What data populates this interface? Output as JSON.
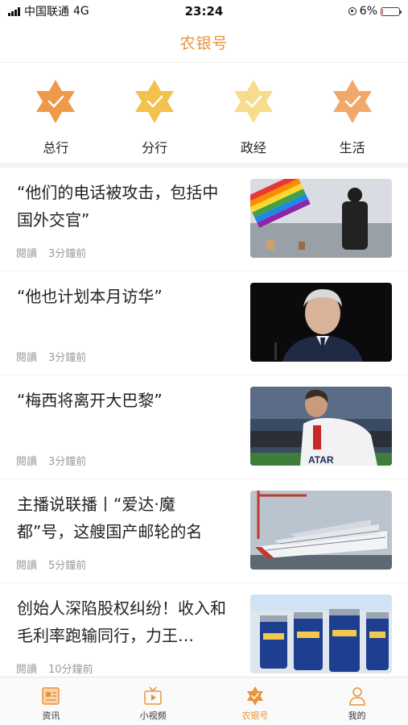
{
  "status_bar": {
    "carrier": "中国联通",
    "network": "4G",
    "time": "23:24",
    "battery": "6%",
    "battery_level": 0.06
  },
  "header": {
    "title": "农银号"
  },
  "categories": [
    {
      "label": "总行",
      "color": "#ef9a4a",
      "icon": "star-check-icon"
    },
    {
      "label": "分行",
      "color": "#f2c14e",
      "icon": "star-check-icon"
    },
    {
      "label": "政经",
      "color": "#f6dc8c",
      "icon": "star-check-icon"
    },
    {
      "label": "生活",
      "color": "#f2a86a",
      "icon": "star-check-icon"
    }
  ],
  "feed": [
    {
      "title": "“他们的电话被攻击，包括中国外交官”",
      "read_label": "閱讀",
      "time": "3分鐘前",
      "thumb": "rainbow-flag-photo"
    },
    {
      "title": "“他也计划本月访华”",
      "read_label": "閱讀",
      "time": "3分鐘前",
      "thumb": "man-portrait-photo"
    },
    {
      "title": "“梅西将离开大巴黎”",
      "read_label": "閱讀",
      "time": "3分鐘前",
      "thumb": "football-player-photo"
    },
    {
      "title": "主播说联播丨“爱达·魔都”号，这艘国产邮轮的名字…",
      "read_label": "閱讀",
      "time": "5分鐘前",
      "thumb": "cruise-ship-photo"
    },
    {
      "title": "创始人深陷股权纠纷！收入和毛利率跑输同行，力王…",
      "read_label": "閱讀",
      "time": "10分鐘前",
      "thumb": "batteries-photo"
    }
  ],
  "tabbar": [
    {
      "label": "资讯",
      "icon": "news-icon",
      "active": false
    },
    {
      "label": "小视频",
      "icon": "tv-icon",
      "active": false
    },
    {
      "label": "农银号",
      "icon": "star-icon",
      "active": true
    },
    {
      "label": "我的",
      "icon": "person-icon",
      "active": false
    }
  ],
  "colors": {
    "accent": "#e8953a"
  }
}
